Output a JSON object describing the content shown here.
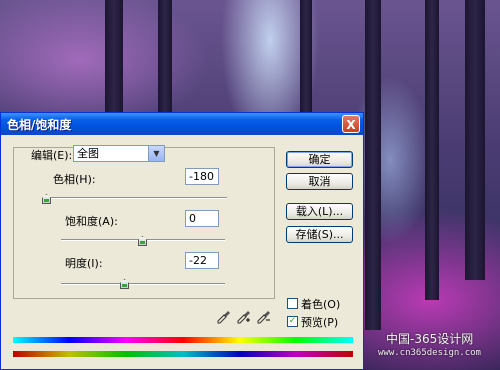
{
  "dialog": {
    "title": "色相/饱和度",
    "close_label": "X"
  },
  "edit": {
    "label": "编辑(E):",
    "selected": "全图"
  },
  "sliders": [
    {
      "label": "色相(H):",
      "value": "-180",
      "range": [
        -180,
        180
      ]
    },
    {
      "label": "饱和度(A):",
      "value": "0",
      "range": [
        -100,
        100
      ]
    },
    {
      "label": "明度(I):",
      "value": "-22",
      "range": [
        -100,
        100
      ]
    }
  ],
  "buttons": {
    "ok": "确定",
    "cancel": "取消",
    "load": "载入(L)...",
    "save": "存储(S)..."
  },
  "checkboxes": {
    "colorize": {
      "label": "着色(O)",
      "checked": false
    },
    "preview": {
      "label": "预览(P)",
      "checked": true
    }
  },
  "icons": {
    "close": "close-icon",
    "dropdown": "chevron-down-icon",
    "eyedropper": "eyedropper-icon",
    "eyedropper_plus": "eyedropper-plus-icon",
    "eyedropper_minus": "eyedropper-minus-icon"
  },
  "watermark": {
    "line1": "中国-365设计网",
    "line2": "www.cn365design.com"
  },
  "colors": {
    "title_bar": "#0a5fe8",
    "dialog_bg": "#ece9d8",
    "close_button": "#c8401f"
  }
}
